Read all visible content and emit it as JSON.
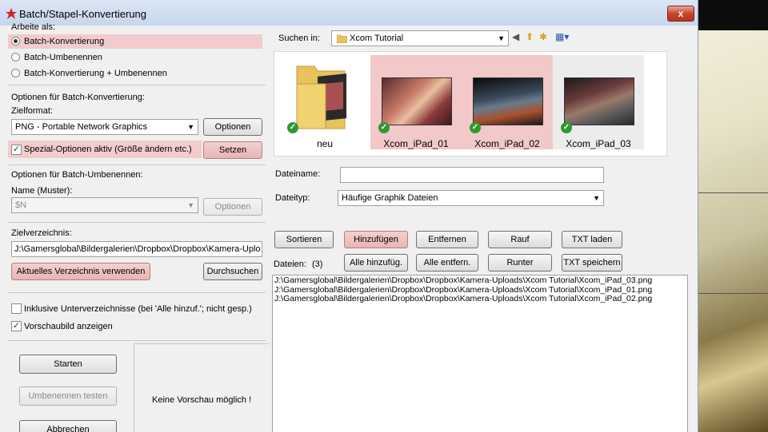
{
  "window": {
    "title": "Batch/Stapel-Konvertierung",
    "close_label": "x"
  },
  "work_as": {
    "heading": "Arbeite als:",
    "options": [
      "Batch-Konvertierung",
      "Batch-Umbenennen",
      "Batch-Konvertierung + Umbenennen"
    ],
    "selected_index": 0
  },
  "convert_options": {
    "heading": "Optionen für Batch-Konvertierung:",
    "format_label": "Zielformat:",
    "format_value": "PNG - Portable Network Graphics",
    "options_button": "Optionen",
    "special_checkbox_label": "Spezial-Optionen aktiv (Größe ändern etc.)",
    "special_checked": true,
    "set_button": "Setzen"
  },
  "rename_options": {
    "heading": "Optionen für Batch-Umbenennen:",
    "name_label": "Name (Muster):",
    "name_value": "$N",
    "options_button": "Optionen"
  },
  "target_dir": {
    "heading": "Zielverzeichnis:",
    "path": "J:\\Gamersglobal\\Bildergalerien\\Dropbox\\Dropbox\\Kamera-Uplo",
    "use_current_button": "Aktuelles Verzeichnis verwenden",
    "browse_button": "Durchsuchen"
  },
  "include_subdirs": {
    "label": "Inklusive Unterverzeichnisse (bei 'Alle hinzuf.'; nicht gesp.)",
    "checked": false
  },
  "show_preview": {
    "label": "Vorschaubild anzeigen",
    "checked": true
  },
  "actions": {
    "start": "Starten",
    "test_rename": "Umbenennen testen",
    "cancel": "Abbrechen"
  },
  "preview_text": "Keine Vorschau möglich !",
  "browser": {
    "search_in_label": "Suchen in:",
    "folder": "Xcom Tutorial",
    "thumbnails": [
      {
        "name": "neu",
        "type": "folder"
      },
      {
        "name": "Xcom_iPad_01",
        "type": "image"
      },
      {
        "name": "Xcom_iPad_02",
        "type": "image"
      },
      {
        "name": "Xcom_iPad_03",
        "type": "image"
      }
    ],
    "filename_label": "Dateiname:",
    "filename_value": "",
    "filetype_label": "Dateityp:",
    "filetype_value": "Häufige Graphik Dateien"
  },
  "list_buttons": {
    "sort": "Sortieren",
    "add": "Hinzufügen",
    "remove": "Entfernen",
    "up": "Rauf",
    "load_txt": "TXT laden",
    "add_all": "Alle hinzufüg.",
    "remove_all": "Alle entfern.",
    "down": "Runter",
    "save_txt": "TXT speichern"
  },
  "files": {
    "label": "Dateien:",
    "count": "(3)",
    "items": [
      "J:\\Gamersglobal\\Bildergalerien\\Dropbox\\Dropbox\\Kamera-Uploads\\Xcom Tutorial\\Xcom_iPad_03.png",
      "J:\\Gamersglobal\\Bildergalerien\\Dropbox\\Dropbox\\Kamera-Uploads\\Xcom Tutorial\\Xcom_iPad_01.png",
      "J:\\Gamersglobal\\Bildergalerien\\Dropbox\\Dropbox\\Kamera-Uploads\\Xcom Tutorial\\Xcom_iPad_02.png"
    ]
  }
}
